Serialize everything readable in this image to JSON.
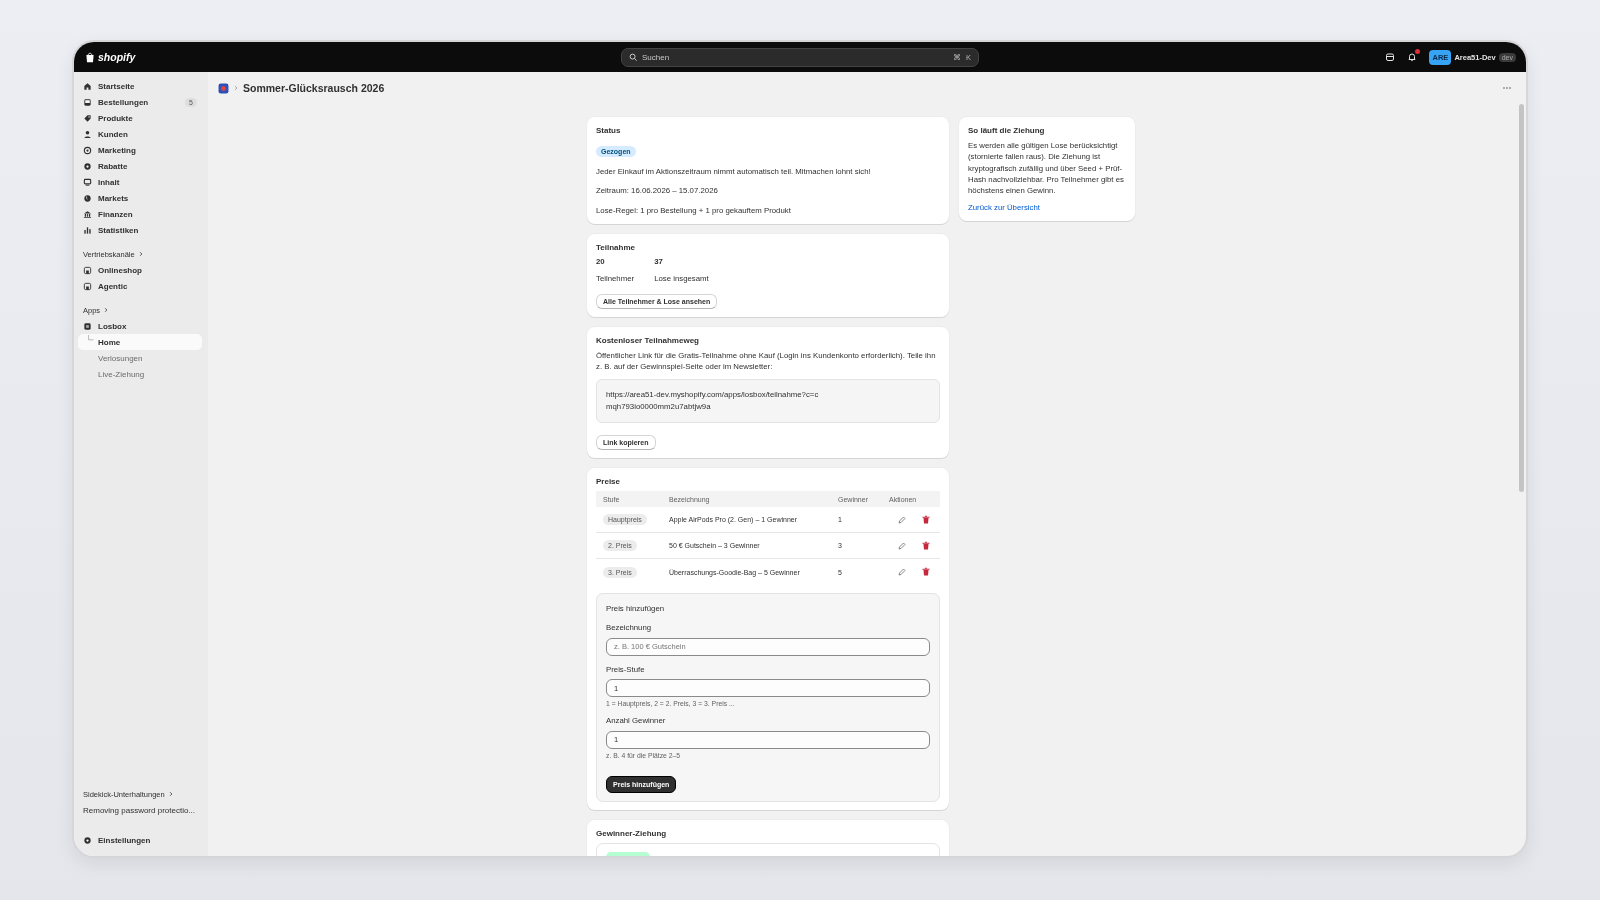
{
  "topbar": {
    "logo": "shopify",
    "search": {
      "placeholder": "Suchen",
      "keys": [
        "⌘",
        "K"
      ]
    },
    "notifications": {
      "unread": true
    },
    "user": {
      "initials": "ARE",
      "name": "Area51-Dev",
      "tag": "dev"
    }
  },
  "sidebar": {
    "items": [
      {
        "label": "Startseite",
        "selected": false
      },
      {
        "label": "Bestellungen",
        "badge": "5",
        "selected": false
      },
      {
        "label": "Produkte",
        "selected": false
      },
      {
        "label": "Kunden",
        "selected": false
      },
      {
        "label": "Marketing",
        "selected": false
      },
      {
        "label": "Rabatte",
        "selected": false
      },
      {
        "label": "Inhalt",
        "selected": false
      },
      {
        "label": "Markets",
        "selected": false
      },
      {
        "label": "Finanzen",
        "selected": false
      },
      {
        "label": "Statistiken",
        "selected": false
      }
    ],
    "sales_channels": {
      "heading": "Vertriebskanäle",
      "items": [
        {
          "label": "Onlineshop",
          "selected": false
        },
        {
          "label": "Agentic",
          "selected": false
        }
      ]
    },
    "apps": {
      "heading": "Apps",
      "items": [
        {
          "label": "Losbox",
          "selected": false,
          "children": [
            {
              "label": "Home",
              "selected": true
            },
            {
              "label": "Verlosungen",
              "selected": false
            },
            {
              "label": "Live-Ziehung",
              "selected": false
            }
          ]
        }
      ]
    },
    "sidekick": {
      "heading": "Sidekick-Unterhaltungen",
      "items": [
        "Removing password protectio..."
      ]
    },
    "settings": {
      "label": "Einstellungen",
      "selected": false
    }
  },
  "page": {
    "title": "Sommer-Glücksrausch 2026"
  },
  "status_card": {
    "title": "Status",
    "badge": "Gezogen",
    "paragraphs": [
      "Jeder Einkauf im Aktionszeitraum nimmt automatisch teil. Mitmachen lohnt sich!",
      "Zeitraum: 16.06.2026 – 15.07.2026",
      "Lose-Regel: 1 pro Bestellung + 1 pro gekauftem Produkt"
    ]
  },
  "participation_card": {
    "title": "Teilnahme",
    "stats": [
      {
        "value": "20",
        "label": "Teilnehmer"
      },
      {
        "value": "37",
        "label": "Lose insgesamt"
      }
    ],
    "button": "Alle Teilnehmer & Lose ansehen"
  },
  "free_entry_card": {
    "title": "Kostenloser Teilnahmeweg",
    "description": "Öffentlicher Link für die Gratis-Teilnahme ohne Kauf (Login ins Kundenkonto erforderlich). Teile ihn z. B. auf der Gewinnspiel-Seite oder im Newsletter:",
    "link": "https://area51-dev.myshopify.com/apps/losbox/teilnahme?c=cmqh793io0000mm2u7abtjw9a",
    "button": "Link kopieren"
  },
  "prizes_card": {
    "title": "Preise",
    "columns": [
      "Stufe",
      "Bezeichnung",
      "Gewinner",
      "Aktionen"
    ],
    "rows": [
      {
        "tier": "Hauptpreis",
        "name": "Apple AirPods Pro (2. Gen) – 1 Gewinner",
        "winners": "1"
      },
      {
        "tier": "2. Preis",
        "name": "50 € Gutschein – 3 Gewinner",
        "winners": "3"
      },
      {
        "tier": "3. Preis",
        "name": "Überraschungs-Goodie-Bag – 5 Gewinner",
        "winners": "5"
      }
    ],
    "add_form": {
      "title": "Preis hinzufügen",
      "fields": [
        {
          "label": "Bezeichnung",
          "placeholder": "z. B. 100 € Gutschein"
        },
        {
          "label": "Preis-Stufe",
          "value": "1",
          "help": "1 = Hauptpreis, 2 = 2. Preis, 3 = 3. Preis ..."
        },
        {
          "label": "Anzahl Gewinner",
          "value": "1",
          "help": "z. B. 4 für die Plätze 2–5"
        }
      ],
      "button": "Preis hinzufügen"
    }
  },
  "draw_card": {
    "title": "Gewinner-Ziehung"
  },
  "info_card": {
    "title": "So läuft die Ziehung",
    "text": "Es werden alle gültigen Lose berücksichtigt (stornierte fallen raus). Die Ziehung ist kryptografisch zufällig und über Seed + Prüf-Hash nachvollziehbar. Pro Teilnehmer gibt es höchstens einen Gewinn.",
    "link": "Zurück zur Übersicht"
  }
}
